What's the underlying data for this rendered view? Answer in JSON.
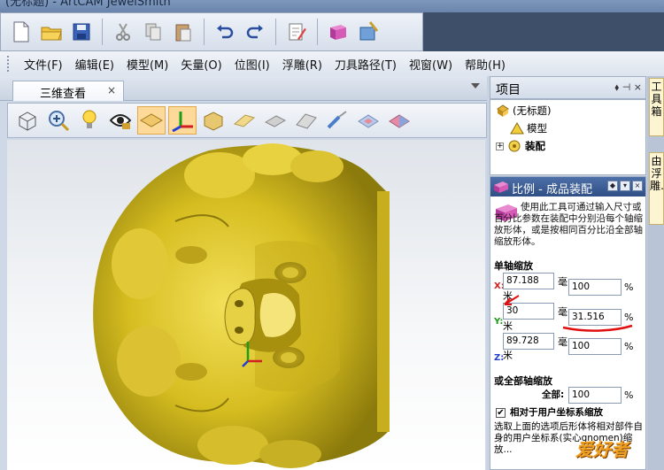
{
  "window": {
    "title": "(无标题) - ArtCAM JewelSmith"
  },
  "toolbar_top": {
    "icons": [
      "new-file-icon",
      "open-folder-icon",
      "save-icon",
      "cut-icon",
      "copy-icon",
      "paste-icon",
      "undo-icon",
      "redo-icon",
      "edit-notes-icon",
      "book-icon",
      "wizard-icon"
    ]
  },
  "menu": {
    "items": [
      "文件(F)",
      "编辑(E)",
      "模型(M)",
      "矢量(O)",
      "位图(I)",
      "浮雕(R)",
      "刀具路径(T)",
      "视窗(W)",
      "帮助(H)"
    ]
  },
  "view_tab": {
    "label": "三维查看",
    "close": "×"
  },
  "project": {
    "title": "项目",
    "controls": "⬧ ⊣ ×",
    "tree": {
      "root": "(无标题)",
      "model": "模型",
      "assembly": "装配",
      "expander": "+"
    }
  },
  "side_tabs": [
    "工具箱",
    "由浮雕…"
  ],
  "scale_panel": {
    "title": "比例 - 成品装配",
    "description": "使用此工具可通过输入尺寸或百分比参数在装配中分别沿每个轴缩放形体，或是按相同百分比沿全部轴缩放形体。",
    "single_axis_title": "单轴缩放",
    "x": {
      "label": "X:",
      "value": "87.188",
      "unit_a": "毫",
      "unit_b": "米",
      "percent": "100",
      "pct_sign": "%"
    },
    "y": {
      "label": "Y:",
      "value": "30",
      "unit_a": "毫",
      "unit_b": "米",
      "percent": "31.516",
      "pct_sign": "%"
    },
    "z": {
      "label": "Z:",
      "value": "89.728",
      "unit_a": "毫",
      "unit_b": "米",
      "percent": "100",
      "pct_sign": "%"
    },
    "all_axis_title": "或全部轴缩放",
    "all_label": "全部:",
    "all_percent": "100",
    "all_pct_sign": "%",
    "relative_check_label": "相对于用户坐标系缩放",
    "relative_desc": "选取上面的选项后形体将相对部件自身的用户坐标系(实心gnomen)缩放..."
  },
  "watermark": "爱好者",
  "colors": {
    "accent_red": "#e01010",
    "panel_header": "#2f4f86",
    "model_gold": "#d4b820"
  }
}
